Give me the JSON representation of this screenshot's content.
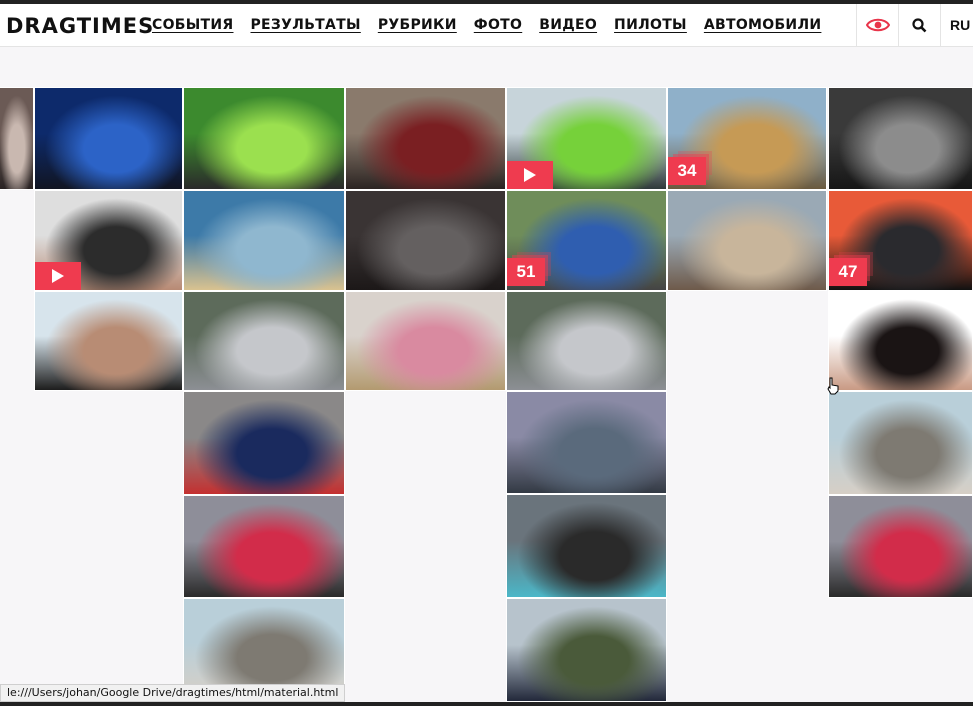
{
  "header": {
    "logo": "DRAGTIMES",
    "nav": [
      "СОБЫТИЯ",
      "РЕЗУЛЬТАТЫ",
      "РУБРИКИ",
      "ФОТО",
      "ВИДЕО",
      "ПИЛОТЫ",
      "АВТОМОБИЛИ"
    ],
    "language": "RU"
  },
  "tiles": [
    {
      "name": "tile-wheel-partial",
      "badge": null,
      "video": false,
      "theme": "wheel"
    },
    {
      "name": "tile-blue-sportscar",
      "badge": null,
      "video": false,
      "theme": "bluecar"
    },
    {
      "name": "tile-green-drift-car",
      "badge": null,
      "video": false,
      "theme": "greencar"
    },
    {
      "name": "tile-vintage-racer",
      "badge": null,
      "video": false,
      "theme": "vintage"
    },
    {
      "name": "tile-green-car-video",
      "badge": null,
      "video": true,
      "theme": "greencar2"
    },
    {
      "name": "tile-desert-road-gallery",
      "badge": "34",
      "video": false,
      "theme": "desert"
    },
    {
      "name": "tile-dragster-partial",
      "badge": null,
      "video": false,
      "theme": "dragster"
    },
    {
      "name": "tile-driver-video",
      "badge": null,
      "video": true,
      "theme": "driver"
    },
    {
      "name": "tile-sky-landscape",
      "badge": null,
      "video": false,
      "theme": "sky"
    },
    {
      "name": "tile-wheel-closeup",
      "badge": null,
      "video": false,
      "theme": "wheeldark"
    },
    {
      "name": "tile-blue-golf-gallery",
      "badge": "51",
      "video": false,
      "theme": "golf"
    },
    {
      "name": "tile-jumping-man",
      "badge": null,
      "video": false,
      "theme": "jump"
    },
    {
      "name": "tile-porsche-gallery",
      "badge": "47",
      "video": false,
      "theme": "porsche"
    },
    {
      "name": "tile-driver-portrait",
      "badge": null,
      "video": false,
      "theme": "portrait"
    },
    {
      "name": "tile-silver-car-rear",
      "badge": null,
      "video": false,
      "theme": "silver"
    },
    {
      "name": "tile-woman-blonde",
      "badge": null,
      "video": false,
      "theme": "woman"
    },
    {
      "name": "tile-silver-car-rear-2",
      "badge": null,
      "video": false,
      "theme": "silver"
    },
    {
      "name": "tile-woman-sunglasses",
      "badge": null,
      "video": false,
      "theme": "sunglasses"
    },
    {
      "name": "tile-f1-car",
      "badge": null,
      "video": false,
      "theme": "f1"
    },
    {
      "name": "tile-road-cars",
      "badge": null,
      "video": false,
      "theme": "roadcars"
    },
    {
      "name": "tile-runway-man",
      "badge": null,
      "video": false,
      "theme": "runway"
    },
    {
      "name": "tile-drift-red-car",
      "badge": null,
      "video": false,
      "theme": "redcar"
    },
    {
      "name": "tile-celebrating-man",
      "badge": null,
      "video": false,
      "theme": "celebrate"
    },
    {
      "name": "tile-drift-red-car-2",
      "badge": null,
      "video": false,
      "theme": "redcar"
    },
    {
      "name": "tile-runway-man-2",
      "badge": null,
      "video": false,
      "theme": "runway"
    },
    {
      "name": "tile-pilots",
      "badge": null,
      "video": false,
      "theme": "pilots"
    }
  ],
  "status_url": "le:///Users/johan/Google Drive/dragtimes/html/material.html"
}
